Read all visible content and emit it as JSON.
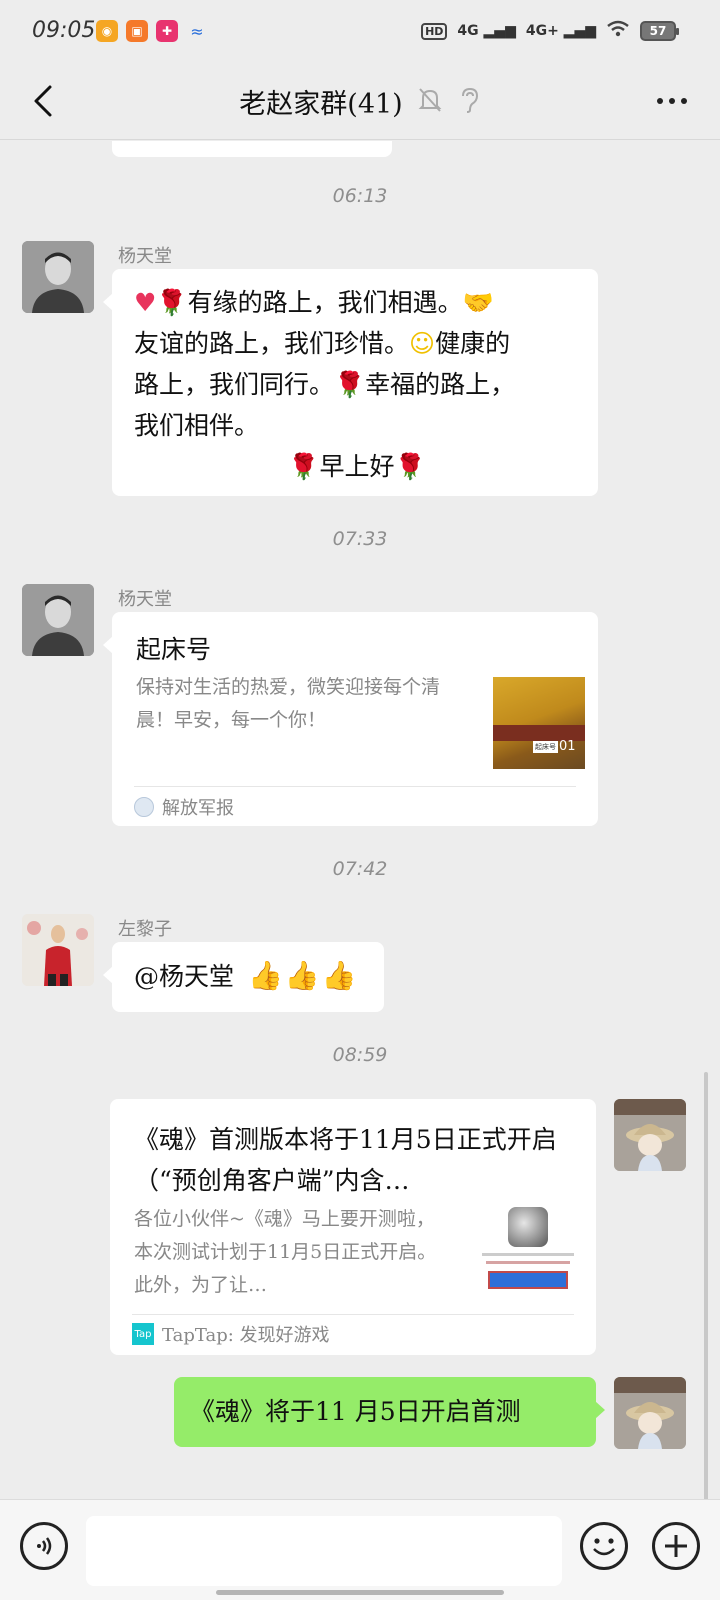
{
  "status_bar": {
    "time": "09:05",
    "signal_1": "4G",
    "signal_2": "4G+",
    "battery": "57"
  },
  "navbar": {
    "title": "老赵家群(41)"
  },
  "messages": {
    "ts1": "06:13",
    "m1": {
      "sender": "杨天堂",
      "line1": "有缘的路上，我们相遇。",
      "line2a": "友谊的路上，我们珍惜。",
      "line2b": "健康的",
      "line3a": "路上，我们同行。",
      "line3b": "幸福的路上，",
      "line4": "我们相伴。",
      "line5": "早上好"
    },
    "ts2": "07:33",
    "m2": {
      "sender": "杨天堂",
      "title": "起床号",
      "desc": "保持对生活的热爱，微笑迎接每个清晨！早安，每一个你！",
      "thumb_caption": "起床号",
      "thumb_num": "01",
      "source": "解放军报"
    },
    "ts3": "07:42",
    "m3": {
      "sender": "左黎子",
      "text": "@杨天堂"
    },
    "ts4": "08:59",
    "m4": {
      "title": "《魂》首测版本将于11月5日正式开启（“预创角客户端”内含…",
      "desc": "各位小伙伴~《魂》马上要开测啦，本次测试计划于11月5日正式开启。此外，为了让…",
      "source": "TapTap: 发现好游戏",
      "source_badge": "Tap"
    },
    "m5": {
      "text": "《魂》将于11 月5日开启首测"
    }
  },
  "input": {
    "placeholder": ""
  },
  "colors": {
    "background": "#ededed",
    "bubble_self": "#95ec69",
    "bubble_other": "#ffffff",
    "taptap": "#15c5ce"
  }
}
